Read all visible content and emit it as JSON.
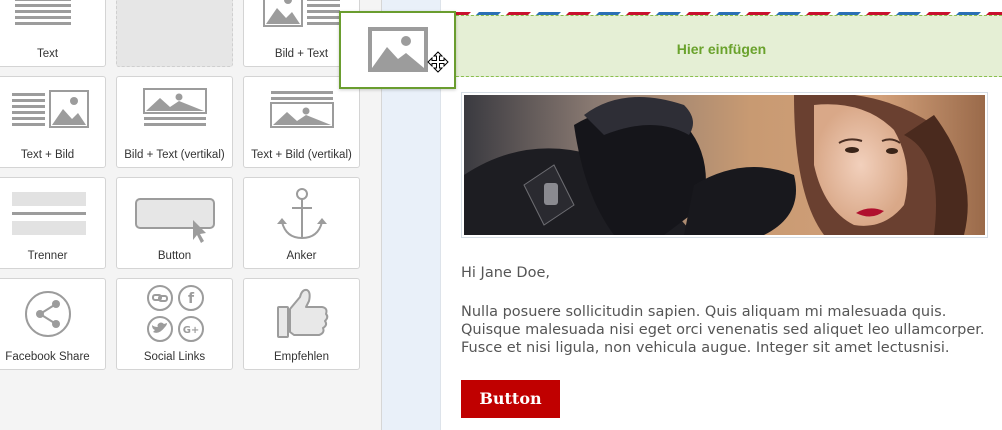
{
  "palette": {
    "tiles": [
      {
        "label": "Text"
      },
      {
        "label": ""
      },
      {
        "label": "Bild + Text"
      },
      {
        "label": "Text + Bild"
      },
      {
        "label": "Bild + Text (vertikal)"
      },
      {
        "label": "Text + Bild (vertikal)"
      },
      {
        "label": "Trenner"
      },
      {
        "label": "Button"
      },
      {
        "label": "Anker"
      },
      {
        "label": "Facebook Share"
      },
      {
        "label": "Social Links"
      },
      {
        "label": "Empfehlen"
      }
    ]
  },
  "canvas": {
    "drop_label": "Hier einfügen",
    "greeting": "Hi Jane Doe,",
    "body": "Nulla posuere sollicitudin sapien. Quis aliquam mi malesuada quis. Quisque malesuada nisi eget orci venenatis sed aliquet leo ullamcorper. Fusce et nisi ligula, non vehicula augue. Integer sit amet lectusnisi.",
    "button_label": "Button"
  },
  "drag": {
    "ghost_icon": "image-icon",
    "cursor": "move-cursor-icon"
  },
  "colors": {
    "accent_green": "#6aa22c",
    "drop_bg": "#e5efd5",
    "button_red": "#c00000",
    "airmail_red": "#c8102e",
    "airmail_blue": "#2a6fb5"
  }
}
